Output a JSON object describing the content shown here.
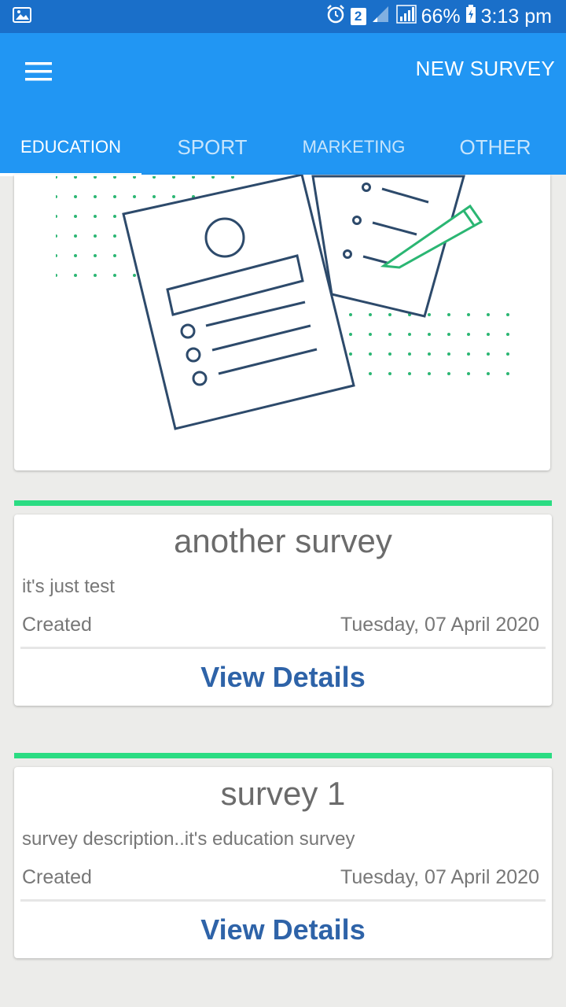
{
  "status_bar": {
    "sim_badge": "2",
    "battery": "66%",
    "time": "3:13 pm"
  },
  "app_bar": {
    "action_label": "NEW SURVEY"
  },
  "tabs": [
    {
      "label": "EDUCATION",
      "active": true
    },
    {
      "label": "SPORT",
      "active": false
    },
    {
      "label": "MARKETING",
      "active": false
    },
    {
      "label": "OTHER",
      "active": false
    }
  ],
  "colors": {
    "status_bar": "#1a6fc9",
    "app_bar": "#2196f3",
    "accent_green": "#2bdc83",
    "link_blue": "#2e63a8",
    "illustration_stroke": "#2d4a6b"
  },
  "surveys": [
    {
      "title": "another survey",
      "description": "it's just test",
      "created_label": "Created",
      "created_date": "Tuesday, 07 April 2020",
      "action_label": "View Details"
    },
    {
      "title": "survey 1",
      "description": "survey description..it's education survey",
      "created_label": "Created",
      "created_date": "Tuesday, 07 April 2020",
      "action_label": "View Details"
    }
  ]
}
